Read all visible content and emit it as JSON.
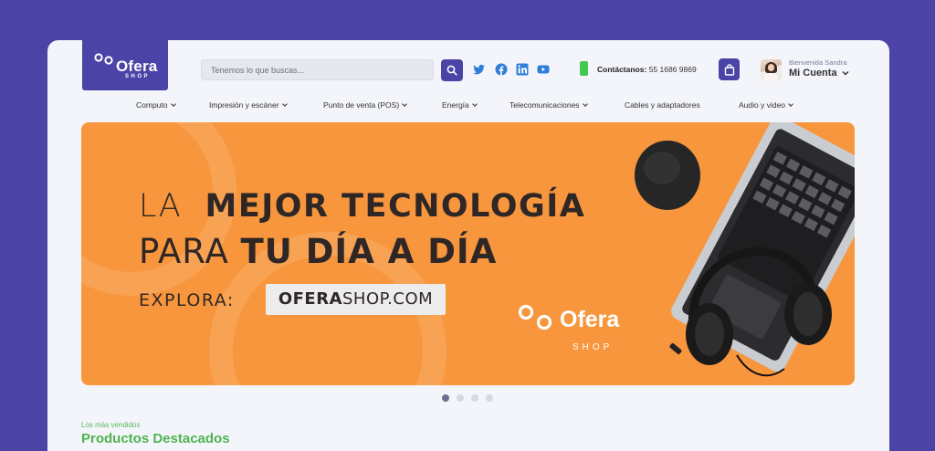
{
  "brand": {
    "logo_name": "Ofera",
    "logo_sub": "SHOP",
    "primary_color": "#4b44a6",
    "accent_green": "#4fb34f",
    "banner_orange": "#f8963d"
  },
  "header": {
    "search_placeholder": "Tenemos lo que buscas...",
    "social_icons": [
      "twitter-icon",
      "facebook-icon",
      "linkedin-icon",
      "youtube-icon"
    ],
    "contact_label": "Contáctanos:",
    "contact_phone": "55 1686 9869",
    "welcome": "Bienvenida Sandra",
    "account_label": "Mi Cuenta"
  },
  "nav": {
    "items": [
      {
        "label": "Computo",
        "has_dropdown": true
      },
      {
        "label": "Impresión y escáner",
        "has_dropdown": true
      },
      {
        "label": "Punto de venta (POS)",
        "has_dropdown": true
      },
      {
        "label": "Energía",
        "has_dropdown": true
      },
      {
        "label": "Telecomunicaciones",
        "has_dropdown": true
      },
      {
        "label": "Cables y adaptadores",
        "has_dropdown": false
      },
      {
        "label": "Audio y video",
        "has_dropdown": true
      }
    ]
  },
  "hero": {
    "line1_light": "LA",
    "line1_bold": "MEJOR TECNOLOGÍA",
    "line2_light": "PARA",
    "line2_bold": "TU DÍA A DÍA",
    "explora": "EXPLORA:",
    "url_bold": "OFERA",
    "url_light": "SHOP.COM",
    "logo_name": "Ofera",
    "logo_sub": "SHOP",
    "slides_total": 4,
    "slide_active": 1
  },
  "section": {
    "eyebrow": "Los más vendidos",
    "title": "Productos Destacados"
  }
}
